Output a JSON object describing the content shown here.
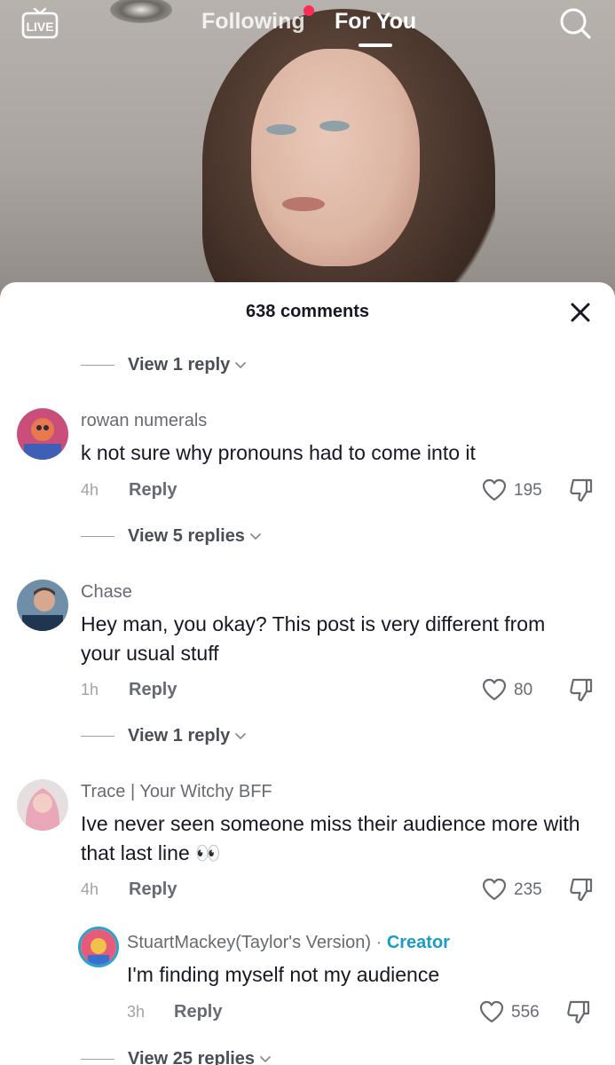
{
  "topnav": {
    "live_label": "LIVE",
    "following_label": "Following",
    "foryou_label": "For You"
  },
  "sheet": {
    "title": "638 comments"
  },
  "view_replies": [
    "View 1 reply",
    "View 5 replies",
    "View 1 reply",
    "View 25 replies"
  ],
  "comments": [
    {
      "username": "rowan numerals",
      "text": "k not sure why pronouns had to come into it",
      "time": "4h",
      "reply_label": "Reply",
      "likes": "195"
    },
    {
      "username": "Chase",
      "text": "Hey man, you okay? This post is very different from your usual stuff",
      "time": "1h",
      "reply_label": "Reply",
      "likes": "80"
    },
    {
      "username": "Trace | Your Witchy BFF",
      "text": "Ive never seen someone miss their audience more with that last line 👀",
      "time": "4h",
      "reply_label": "Reply",
      "likes": "235"
    },
    {
      "username": "StuartMackey(Taylor's Version)",
      "separator": "·",
      "badge": "Creator",
      "text": "I'm finding myself not my audience",
      "time": "3h",
      "reply_label": "Reply",
      "likes": "556"
    }
  ],
  "colors": {
    "accent_dot": "#fe2c55",
    "creator_badge": "#1a9dc4",
    "text_primary": "#161823",
    "text_secondary": "#686a72"
  }
}
